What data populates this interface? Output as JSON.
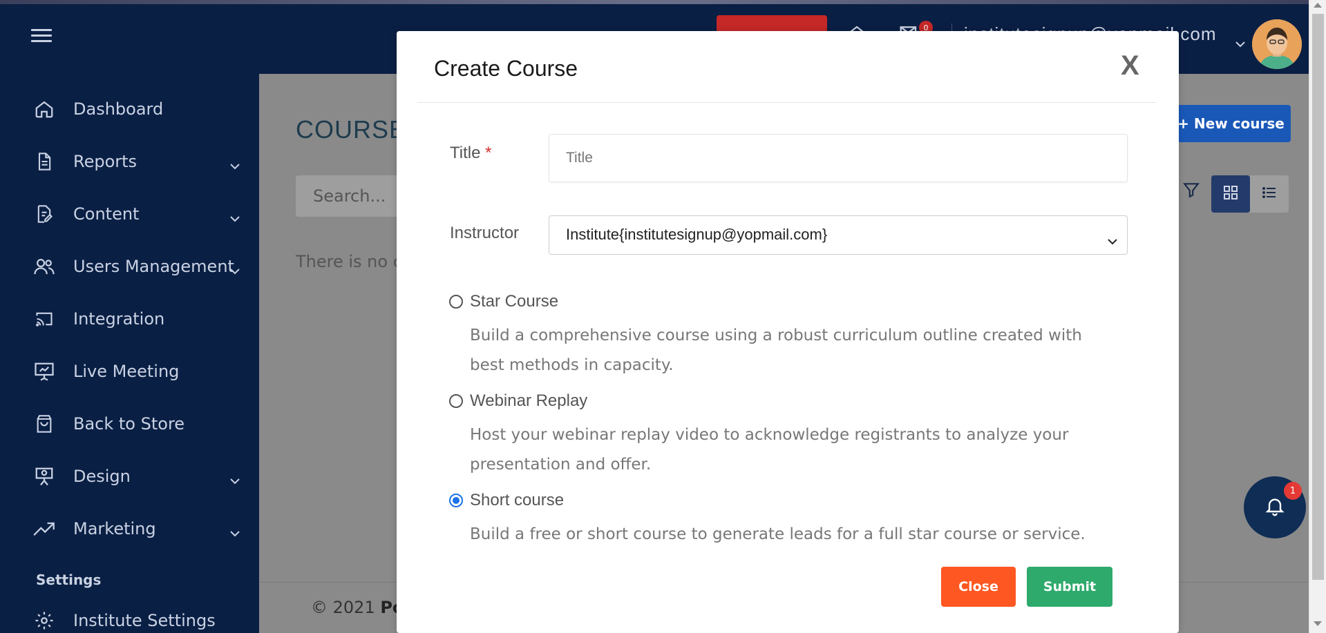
{
  "sidebar": {
    "items": [
      {
        "label": "Dashboard",
        "icon": "home-icon",
        "has_chevron": false
      },
      {
        "label": "Reports",
        "icon": "document-icon",
        "has_chevron": true
      },
      {
        "label": "Content",
        "icon": "edit-document-icon",
        "has_chevron": true
      },
      {
        "label": "Users Management",
        "icon": "users-icon",
        "has_chevron": true
      },
      {
        "label": "Integration",
        "icon": "cast-icon",
        "has_chevron": false
      },
      {
        "label": "Live Meeting",
        "icon": "presentation-icon",
        "has_chevron": false
      },
      {
        "label": "Back to Store",
        "icon": "shopping-bag-icon",
        "has_chevron": false
      },
      {
        "label": "Design",
        "icon": "easel-icon",
        "has_chevron": true
      },
      {
        "label": "Marketing",
        "icon": "trending-up-icon",
        "has_chevron": true
      }
    ],
    "settings_heading": "Settings",
    "institute_settings": "Institute Settings"
  },
  "header": {
    "email": "institutesignup@yopmail.com",
    "cart_count": "0"
  },
  "main": {
    "title": "COURSES",
    "search_placeholder": "Search...",
    "empty_text": "There is no course",
    "new_course_label": "+ New course",
    "copyright_prefix": "© 2021 ",
    "copyright_brand": "Powered"
  },
  "modal": {
    "title": "Create Course",
    "close_x": "X",
    "title_label": "Title",
    "required_mark": "*",
    "title_placeholder": "Title",
    "instructor_label": "Instructor",
    "instructor_value": "Institute{institutesignup@yopmail.com}",
    "options": [
      {
        "title": "Star Course",
        "desc": "Build a comprehensive course using a robust curriculum outline created with best methods in capacity.",
        "selected": false
      },
      {
        "title": "Webinar Replay",
        "desc": "Host your webinar replay video to acknowledge registrants to analyze your presentation and offer.",
        "selected": false
      },
      {
        "title": "Short course",
        "desc": "Build a free or short course to generate leads for a full star course or service.",
        "selected": true
      }
    ],
    "close_button": "Close",
    "submit_button": "Submit"
  },
  "notification_count": "1",
  "colors": {
    "sidebar_bg": "#0a1f44",
    "primary_blue": "#1a58b8",
    "close_orange": "#ff5722",
    "submit_green": "#2eaa6c"
  }
}
